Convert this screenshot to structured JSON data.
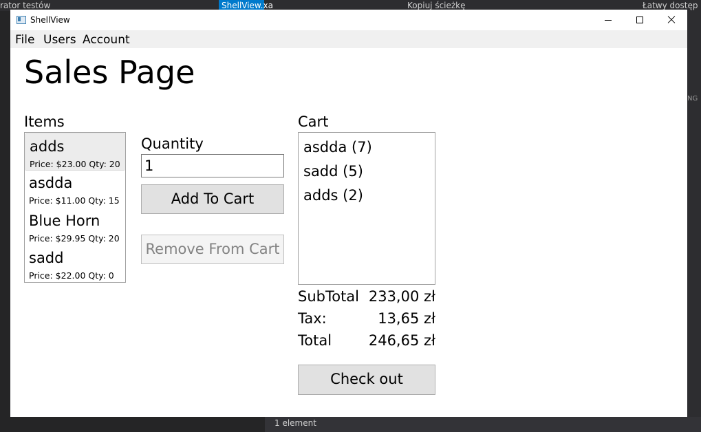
{
  "background": {
    "tab_left": "rator testów",
    "tab_active": "ShellView.xa",
    "toolbar_right1": "Kopiuj ścieżkę",
    "toolbar_right2": "Łatwy dostęp",
    "status_text": "1 element",
    "right_edge_text": "NG"
  },
  "window": {
    "title": "ShellView"
  },
  "menu": {
    "items": [
      {
        "label": "File"
      },
      {
        "label": "Users"
      },
      {
        "label": "Account"
      }
    ]
  },
  "page": {
    "title": "Sales Page",
    "items_label": "Items",
    "quantity_label": "Quantity",
    "cart_label": "Cart"
  },
  "items": [
    {
      "name": "adds",
      "meta": "Price: $23.00  Qty: 20",
      "selected": true
    },
    {
      "name": "asdda",
      "meta": "Price: $11.00  Qty: 15",
      "selected": false
    },
    {
      "name": "Blue Horn",
      "meta": "Price: $29.95  Qty: 20",
      "selected": false
    },
    {
      "name": "sadd",
      "meta": "Price: $22.00  Qty: 0",
      "selected": false
    }
  ],
  "quantity": {
    "value": "1"
  },
  "buttons": {
    "add_to_cart": "Add To Cart",
    "remove_from_cart": "Remove From Cart",
    "check_out": "Check out"
  },
  "cart": [
    {
      "label": "asdda (7)"
    },
    {
      "label": "sadd (5)"
    },
    {
      "label": "adds (2)"
    }
  ],
  "totals": {
    "subtotal_label": "SubTotal",
    "subtotal_value": "233,00 zł",
    "tax_label": "Tax:",
    "tax_value": "13,65 zł",
    "total_label": "Total",
    "total_value": "246,65 zł"
  },
  "colors": {
    "window_bg": "#ffffff",
    "menubar_bg": "#f0f0f0",
    "button_bg": "#e1e1e1",
    "ide_bg": "#1e1e1e",
    "ide_accent": "#007acc"
  }
}
